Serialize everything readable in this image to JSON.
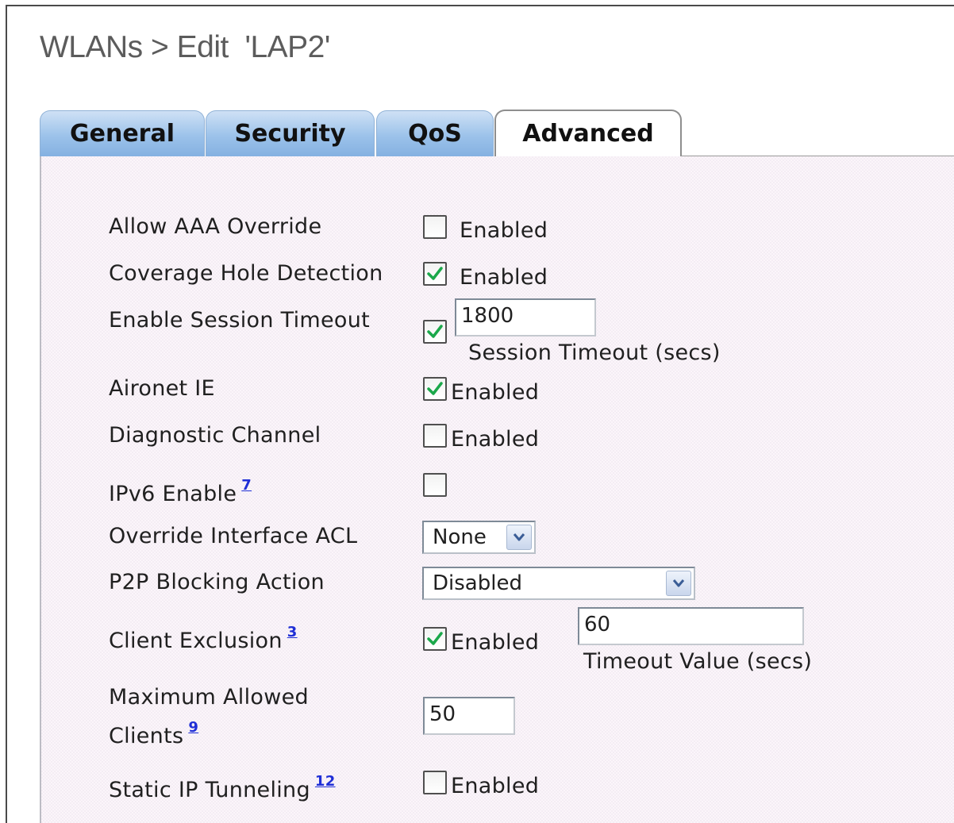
{
  "header": {
    "title": "WLANs > Edit  'LAP2'"
  },
  "tabs": [
    {
      "label": "General",
      "active": false
    },
    {
      "label": "Security",
      "active": false
    },
    {
      "label": "QoS",
      "active": false
    },
    {
      "label": "Advanced",
      "active": true
    }
  ],
  "form": {
    "allow_aaa_override": {
      "label": "Allow AAA Override",
      "checked": false,
      "option": "Enabled"
    },
    "coverage_hole_detection": {
      "label": "Coverage Hole Detection",
      "checked": true,
      "option": "Enabled"
    },
    "session_timeout": {
      "label": "Enable Session Timeout",
      "checked": true,
      "value": "1800",
      "caption": "Session Timeout (secs)"
    },
    "aironet_ie": {
      "label": "Aironet IE",
      "checked": true,
      "option": "Enabled"
    },
    "diagnostic_channel": {
      "label": "Diagnostic Channel",
      "checked": false,
      "option": "Enabled"
    },
    "ipv6_enable": {
      "label": "IPv6 Enable",
      "footnote": "7",
      "checked": false
    },
    "override_interface_acl": {
      "label": "Override Interface ACL",
      "selected": "None"
    },
    "p2p_blocking_action": {
      "label": "P2P Blocking Action",
      "selected": "Disabled"
    },
    "client_exclusion": {
      "label": "Client Exclusion",
      "footnote": "3",
      "checked": true,
      "option": "Enabled",
      "value": "60",
      "caption": "Timeout Value (secs)"
    },
    "max_allowed_clients": {
      "label_line1": "Maximum Allowed",
      "label_line2": "Clients",
      "footnote": "9",
      "value": "50"
    },
    "static_ip_tunneling": {
      "label": "Static IP Tunneling",
      "footnote": "12",
      "checked": false,
      "option": "Enabled"
    }
  },
  "icons": {
    "checkmark": "check-icon",
    "dropdown": "chevron-down-icon"
  },
  "colors": {
    "tab_blue": "#9cc2ea",
    "check_green": "#1aa84a",
    "footnote_link": "#1f2fd6"
  }
}
